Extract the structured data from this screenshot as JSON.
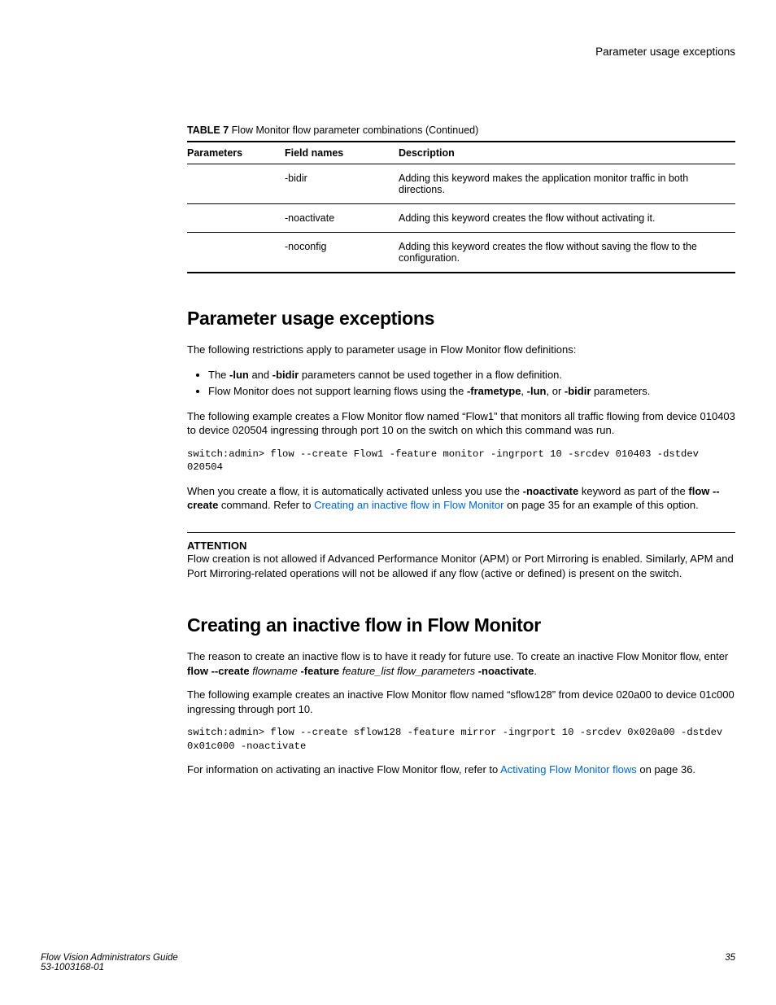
{
  "runningHead": "Parameter usage exceptions",
  "table": {
    "captionLabel": "TABLE 7",
    "captionText": "Flow Monitor flow parameter combinations (Continued)",
    "headers": {
      "c1": "Parameters",
      "c2": "Field names",
      "c3": "Description"
    },
    "rows": [
      {
        "param": "",
        "field": "-bidir",
        "desc": "Adding this keyword makes the application monitor traffic in both directions."
      },
      {
        "param": "",
        "field": "-noactivate",
        "desc": "Adding this keyword creates the flow without activating it."
      },
      {
        "param": "",
        "field": "-noconfig",
        "desc": "Adding this keyword creates the flow without saving the flow to the configuration."
      }
    ]
  },
  "sec1": {
    "title": "Parameter usage exceptions",
    "intro": "The following restrictions apply to parameter usage in Flow Monitor flow definitions:",
    "bullets": {
      "b1a": "The ",
      "b1b": "-lun",
      "b1c": " and ",
      "b1d": "-bidir",
      "b1e": " parameters cannot be used together in a flow definition.",
      "b2a": "Flow Monitor does not support learning flows using the ",
      "b2b": "-frametype",
      "b2c": ", ",
      "b2d": "-lun",
      "b2e": ", or ",
      "b2f": "-bidir",
      "b2g": " parameters."
    },
    "p1": "The following example creates a Flow Monitor flow named “Flow1” that monitors all traffic flowing from device 010403 to device 020504 ingressing through port 10 on the switch on which this command was run.",
    "code1": "switch:admin> flow --create Flow1 -feature monitor -ingrport 10 -srcdev 010403 -dstdev 020504",
    "p2a": "When you create a flow, it is automatically activated unless you use the ",
    "p2b": "-noactivate",
    "p2c": " keyword as part of the ",
    "p2d": "flow --create",
    "p2e": " command. Refer to ",
    "p2link": "Creating an inactive flow in Flow Monitor",
    "p2f": " on page 35 for an example of this option.",
    "attnLabel": "ATTENTION",
    "attnText": "Flow creation is not allowed if Advanced Performance Monitor (APM) or Port Mirroring is enabled. Similarly, APM and Port Mirroring-related operations will not be allowed if any flow (active or defined) is present on the switch."
  },
  "sec2": {
    "title": "Creating an inactive flow in Flow Monitor",
    "p1a": "The reason to create an inactive flow is to have it ready for future use. To create an inactive Flow Monitor flow, enter ",
    "p1b": "flow --create",
    "p1c": " ",
    "p1d": "flowname",
    "p1e": " ",
    "p1f": "-feature",
    "p1g": " ",
    "p1h": "feature_list flow_parameters",
    "p1i": " ",
    "p1j": "-noactivate",
    "p1k": ".",
    "p2": "The following example creates an inactive Flow Monitor flow named “sflow128” from device 020a00 to device 01c000 ingressing through port 10.",
    "code2": "switch:admin> flow --create sflow128 -feature mirror -ingrport 10 -srcdev 0x020a00 -dstdev 0x01c000 -noactivate",
    "p3a": "For information on activating an inactive Flow Monitor flow, refer to ",
    "p3link": "Activating Flow Monitor flows",
    "p3b": " on page 36."
  },
  "footer": {
    "title": "Flow Vision Administrators Guide",
    "docnum": "53-1003168-01",
    "pagenum": "35"
  }
}
